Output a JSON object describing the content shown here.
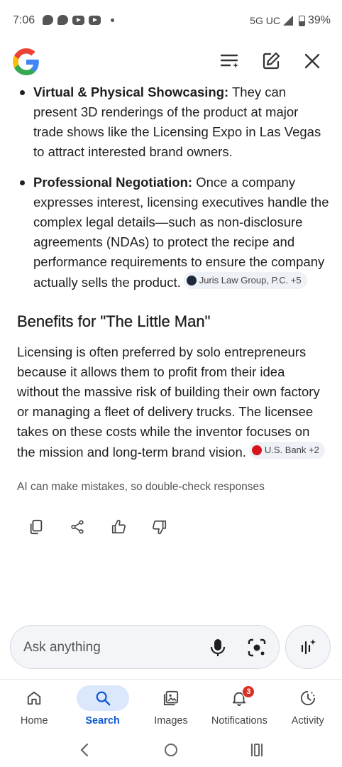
{
  "status_bar": {
    "time": "7:06",
    "network": "5G UC",
    "battery": "39%"
  },
  "header": {
    "logo": "google-g-logo",
    "actions": [
      "list-icon",
      "edit-icon",
      "close-icon"
    ]
  },
  "bullets": [
    {
      "title": "Virtual & Physical Showcasing:",
      "text": " They can present 3D renderings of the product at major trade shows like the Licensing Expo in Las Vegas to attract interested brand owners."
    },
    {
      "title": "Professional Negotiation:",
      "text": " Once a company expresses interest, licensing executives handle the complex legal details—such as non-disclosure agreements (NDAs) to protect the recipe and performance requirements to ensure the company actually sells the product.",
      "source": "Juris Law Group, P.C. +5"
    }
  ],
  "section": {
    "heading": "Benefits for \"The Little Man\"",
    "paragraph": "Licensing is often preferred by solo entrepreneurs because it allows them to profit from their idea without the massive risk of building their own factory or managing a fleet of delivery trucks. The licensee takes on these costs while the inventor focuses on the mission and long-term brand vision.",
    "source": "U.S. Bank +2"
  },
  "disclaimer": "AI can make mistakes, so double-check responses",
  "ask": {
    "placeholder": "Ask anything"
  },
  "nav": {
    "items": [
      {
        "label": "Home",
        "icon": "home-icon"
      },
      {
        "label": "Search",
        "icon": "search-icon",
        "active": true
      },
      {
        "label": "Images",
        "icon": "images-icon"
      },
      {
        "label": "Notifications",
        "icon": "bell-icon",
        "badge": "3"
      },
      {
        "label": "Activity",
        "icon": "activity-icon"
      }
    ]
  },
  "colors": {
    "accent": "#0b57d0",
    "active_pill": "#dbe7fd",
    "badge": "#d93025"
  }
}
